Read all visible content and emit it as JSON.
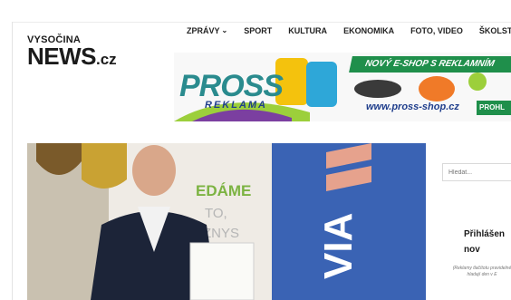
{
  "logo": {
    "top": "VYSOČINA",
    "main": "NEWS",
    "tld": ".cz"
  },
  "nav": [
    {
      "label": "ZPRÁVY",
      "has_dropdown": true
    },
    {
      "label": "SPORT"
    },
    {
      "label": "KULTURA"
    },
    {
      "label": "EKONOMIKA"
    },
    {
      "label": "FOTO, VIDEO"
    },
    {
      "label": "ŠKOLST"
    }
  ],
  "banner": {
    "brand": "PROSS",
    "sub": "REKLAMA",
    "headline": "NOVÝ E-SHOP S REKLAMNÍM",
    "url": "www.pross-shop.cz",
    "cta": "PROHL",
    "colors": {
      "green": "#1f8f4b",
      "teal": "#2a8b8e",
      "blue": "#1f3e8c"
    }
  },
  "hero": {
    "wall_text": [
      "EDÁME",
      "TO,",
      "ZNYS"
    ],
    "banner_text": "VIA",
    "colors": {
      "blue_banner": "#3a63b4",
      "wall": "#efebe5",
      "jacket": "#1c2438"
    }
  },
  "sidebar": {
    "search_placeholder": "Hledat...",
    "login_title": "Přihlášen nov",
    "login_note": "(Reklamy tlačítotu pravidelné hladají den v E"
  }
}
